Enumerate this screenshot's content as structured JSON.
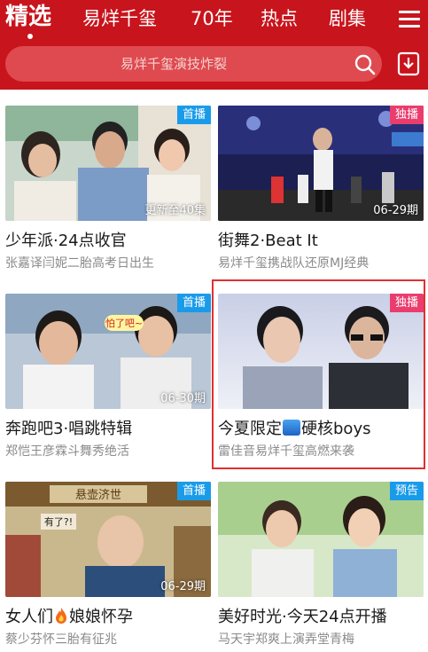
{
  "nav": {
    "tabs": [
      {
        "label": "精选"
      },
      {
        "label": "易烊千玺"
      },
      {
        "label": "70年"
      },
      {
        "label": "热点"
      },
      {
        "label": "剧集"
      }
    ]
  },
  "search": {
    "placeholder": "易烊千玺演技炸裂"
  },
  "colors": {
    "header_red": "#c8141c",
    "badge_blue": "#1a9bea",
    "badge_pink": "#ea3d6e",
    "highlight_border": "#e03030"
  },
  "cards": [
    {
      "badge": "首播",
      "overlay": "更新至40集",
      "title": "少年派·24点收官",
      "subtitle": "张嘉译闫妮二胎高考日出生"
    },
    {
      "badge": "独播",
      "overlay": "06-29期",
      "title": "街舞2·Beat It",
      "subtitle": "易烊千玺携战队还原MJ经典"
    },
    {
      "badge": "首播",
      "overlay": "06-30期",
      "title": "奔跑吧3·唱跳特辑",
      "subtitle": "郑恺王彦霖斗舞秀绝活",
      "thumb_caption": "怕了吧~"
    },
    {
      "badge": "独播",
      "title_a": "今夏限定",
      "title_b": "硬核boys",
      "subtitle": "雷佳音易烊千玺高燃来袭"
    },
    {
      "badge": "首播",
      "overlay": "06-29期",
      "title_a": "女人们",
      "title_b": "娘娘怀孕",
      "subtitle": "蔡少芬怀三胎有征兆",
      "thumb_caption": "悬壶济世",
      "thumb_caption2": "有了?!"
    },
    {
      "badge": "预告",
      "title": "美好时光·今天24点开播",
      "subtitle": "马天宇郑爽上演弄堂青梅"
    }
  ]
}
